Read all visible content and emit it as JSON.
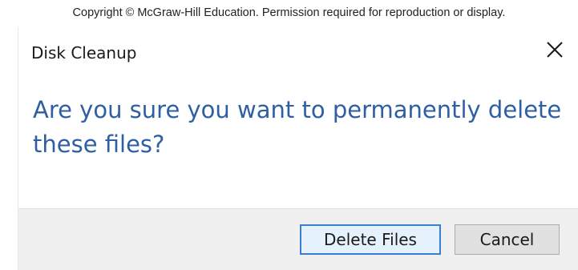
{
  "copyright": "Copyright © McGraw-Hill Education. Permission required for reproduction or display.",
  "dialog": {
    "title": "Disk Cleanup",
    "close_icon": "close-icon",
    "main_instruction": "Are you sure you want to permanently delete these files?",
    "buttons": {
      "delete_label": "Delete Files",
      "cancel_label": "Cancel"
    }
  },
  "colors": {
    "instruction_text": "#2e5fa3",
    "footer_background": "#f0f0f0",
    "default_button_border": "#3c7fd1"
  }
}
